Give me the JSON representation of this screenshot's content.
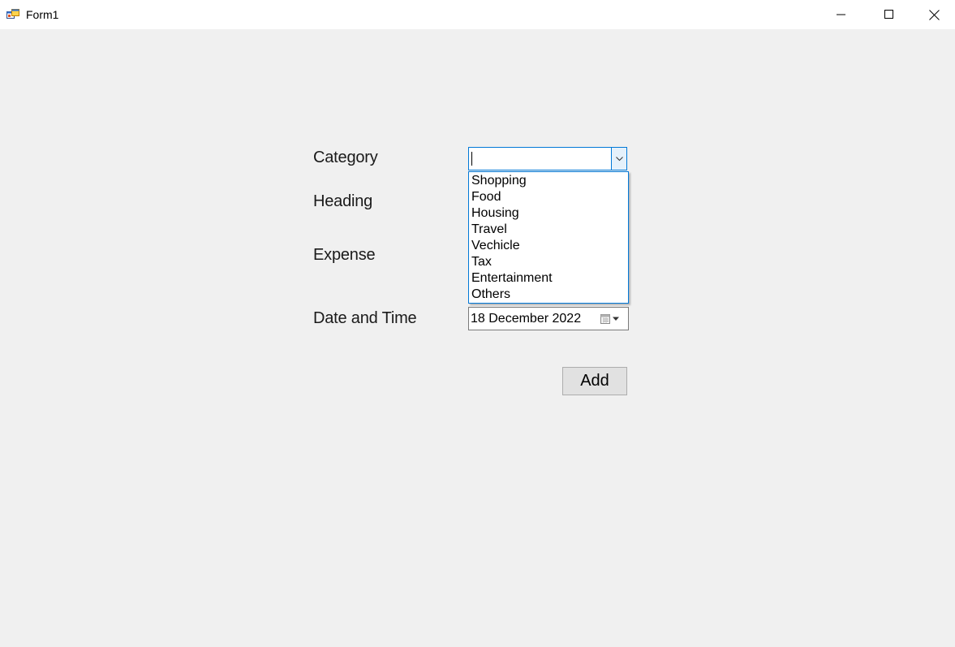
{
  "window": {
    "title": "Form1"
  },
  "form": {
    "labels": {
      "category": "Category",
      "heading": "Heading",
      "expense": "Expense",
      "date_time": "Date and Time"
    },
    "category_combo": {
      "value": "",
      "expanded": true,
      "options": [
        "Shopping",
        "Food",
        "Housing",
        "Travel",
        "Vechicle",
        "Tax",
        "Entertainment",
        "Others"
      ]
    },
    "date_picker": {
      "value": "18 December 2022"
    },
    "add_button_label": "Add"
  },
  "colors": {
    "accent": "#0078d7",
    "window_bg": "#f0f0f0",
    "button_bg": "#e1e1e1"
  }
}
